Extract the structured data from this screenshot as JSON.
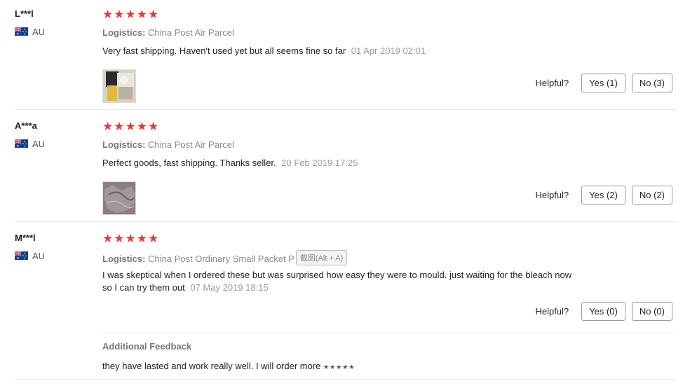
{
  "reviews": [
    {
      "name": "L***l",
      "country": "AU",
      "stars": 5,
      "logistics_label": "Logistics:",
      "logistics": "China Post Air Parcel",
      "text": "Very fast shipping. Haven't used yet but all seems fine so far",
      "date": "01 Apr 2019 02:01",
      "helpful_label": "Helpful?",
      "yes": "Yes (1)",
      "no": "No (3)"
    },
    {
      "name": "A***a",
      "country": "AU",
      "stars": 5,
      "logistics_label": "Logistics:",
      "logistics": "China Post Air Parcel",
      "text": "Perfect goods, fast shipping. Thanks seller.",
      "date": "20 Feb 2019 17:25",
      "helpful_label": "Helpful?",
      "yes": "Yes (2)",
      "no": "No (2)"
    },
    {
      "name": "M***l",
      "country": "AU",
      "stars": 5,
      "logistics_label": "Logistics:",
      "logistics": "China Post Ordinary Small Packet P",
      "tooltip": "截图(Alt + A)",
      "text_line1": "I was skeptical when I ordered these but was surprised how easy they were to mould. just waiting for the bleach now",
      "text_line2": "so I can try them out",
      "date": "07 May 2019 18:15",
      "helpful_label": "Helpful?",
      "yes": "Yes (0)",
      "no": "No (0)",
      "additional_title": "Additional Feedback",
      "additional_text": "they have lasted and work really well. I will order more",
      "additional_stars": "★★★★★"
    }
  ],
  "colors": {
    "star": "#e6393f",
    "divider": "#e8e8e8"
  }
}
